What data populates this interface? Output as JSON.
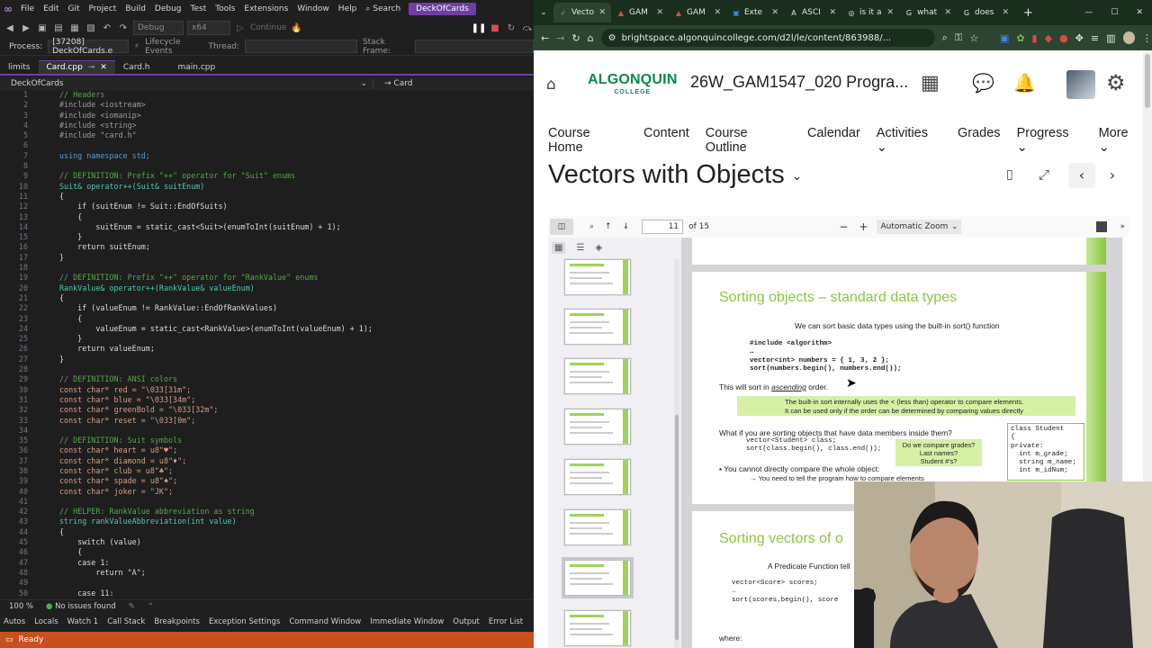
{
  "vs": {
    "menu": [
      "File",
      "Edit",
      "Git",
      "Project",
      "Build",
      "Debug",
      "Test",
      "Tools",
      "Extensions",
      "Window",
      "Help"
    ],
    "search_label": "Search",
    "solution_name": "DeckOfCards",
    "toolbar": {
      "config": "Debug",
      "platform": "x64",
      "continue_label": "Continue"
    },
    "process_label": "Process:",
    "process_value": "[37208] DeckOfCards.e",
    "lifecycle_label": "Lifecycle Events",
    "thread_label": "Thread:",
    "stack_frame_label": "Stack Frame:",
    "tabs": [
      {
        "label": "limits",
        "active": false
      },
      {
        "label": "Card.cpp",
        "active": true
      },
      {
        "label": "Card.h",
        "active": false
      },
      {
        "label": "main.cpp",
        "active": false
      }
    ],
    "nav_left": "DeckOfCards",
    "nav_right": "Card",
    "code_lines": [
      {
        "n": "1",
        "t": "// Headers",
        "c": "c-comment"
      },
      {
        "n": "2",
        "t": "#include <iostream>",
        "c": "c-pp"
      },
      {
        "n": "3",
        "t": "#include <iomanip>",
        "c": "c-pp"
      },
      {
        "n": "4",
        "t": "#include <string>",
        "c": "c-pp"
      },
      {
        "n": "5",
        "t": "#include \"card.h\"",
        "c": "c-pp"
      },
      {
        "n": "6",
        "t": "",
        "c": ""
      },
      {
        "n": "7",
        "t": "using namespace std;",
        "c": "c-kw"
      },
      {
        "n": "8",
        "t": "",
        "c": ""
      },
      {
        "n": "9",
        "t": "// DEFINITION: Prefix \"++\" operator for \"Suit\" enums",
        "c": "c-comment"
      },
      {
        "n": "10",
        "t": "Suit& operator++(Suit& suitEnum)",
        "c": "c-type"
      },
      {
        "n": "11",
        "t": "{",
        "c": ""
      },
      {
        "n": "12",
        "t": "    if (suitEnum != Suit::EndOfSuits)",
        "c": ""
      },
      {
        "n": "13",
        "t": "    {",
        "c": ""
      },
      {
        "n": "14",
        "t": "        suitEnum = static_cast<Suit>(enumToInt(suitEnum) + 1);",
        "c": ""
      },
      {
        "n": "15",
        "t": "    }",
        "c": ""
      },
      {
        "n": "16",
        "t": "    return suitEnum;",
        "c": ""
      },
      {
        "n": "17",
        "t": "}",
        "c": ""
      },
      {
        "n": "18",
        "t": "",
        "c": ""
      },
      {
        "n": "19",
        "t": "// DEFINITION: Prefix \"++\" operator for \"RankValue\" enums",
        "c": "c-comment"
      },
      {
        "n": "20",
        "t": "RankValue& operator++(RankValue& valueEnum)",
        "c": "c-type"
      },
      {
        "n": "21",
        "t": "{",
        "c": ""
      },
      {
        "n": "22",
        "t": "    if (valueEnum != RankValue::EndOfRankValues)",
        "c": ""
      },
      {
        "n": "23",
        "t": "    {",
        "c": ""
      },
      {
        "n": "24",
        "t": "        valueEnum = static_cast<RankValue>(enumToInt(valueEnum) + 1);",
        "c": ""
      },
      {
        "n": "25",
        "t": "    }",
        "c": ""
      },
      {
        "n": "26",
        "t": "    return valueEnum;",
        "c": ""
      },
      {
        "n": "27",
        "t": "}",
        "c": ""
      },
      {
        "n": "28",
        "t": "",
        "c": ""
      },
      {
        "n": "29",
        "t": "// DEFINITION: ANSI colors",
        "c": "c-comment"
      },
      {
        "n": "30",
        "t": "const char* red = \"\\033[31m\";",
        "c": "c-str"
      },
      {
        "n": "31",
        "t": "const char* blue = \"\\033[34m\";",
        "c": "c-str"
      },
      {
        "n": "32",
        "t": "const char* greenBold = \"\\033[32m\";",
        "c": "c-str"
      },
      {
        "n": "33",
        "t": "const char* reset = \"\\033[0m\";",
        "c": "c-str"
      },
      {
        "n": "34",
        "t": "",
        "c": ""
      },
      {
        "n": "35",
        "t": "// DEFINITION: Suit symbols",
        "c": "c-comment"
      },
      {
        "n": "36",
        "t": "const char* heart = u8\"♥\";",
        "c": "c-str"
      },
      {
        "n": "37",
        "t": "const char* diamond = u8\"♦\";",
        "c": "c-str"
      },
      {
        "n": "38",
        "t": "const char* club = u8\"♣\";",
        "c": "c-str"
      },
      {
        "n": "39",
        "t": "const char* spade = u8\"♠\";",
        "c": "c-str"
      },
      {
        "n": "40",
        "t": "const char* joker = \"JK\";",
        "c": "c-str"
      },
      {
        "n": "41",
        "t": "",
        "c": ""
      },
      {
        "n": "42",
        "t": "// HELPER: RankValue abbreviation as string",
        "c": "c-comment"
      },
      {
        "n": "43",
        "t": "string rankValueAbbreviation(int value)",
        "c": "c-type"
      },
      {
        "n": "44",
        "t": "{",
        "c": ""
      },
      {
        "n": "45",
        "t": "    switch (value)",
        "c": ""
      },
      {
        "n": "46",
        "t": "    {",
        "c": ""
      },
      {
        "n": "47",
        "t": "    case 1:",
        "c": ""
      },
      {
        "n": "48",
        "t": "        return \"A\";",
        "c": ""
      },
      {
        "n": "49",
        "t": "",
        "c": ""
      },
      {
        "n": "50",
        "t": "    case 11:",
        "c": ""
      }
    ],
    "zoom": "100 %",
    "issues": "No issues found",
    "bottom_tabs": [
      "Autos",
      "Locals",
      "Watch 1",
      "Call Stack",
      "Breakpoints",
      "Exception Settings",
      "Command Window",
      "Immediate Window",
      "Output",
      "Error List"
    ],
    "status": "Ready",
    "colors": {
      "accent": "#6e3ea6",
      "statusbar": "#c94f1f"
    }
  },
  "browser": {
    "tabs": [
      {
        "label": "Vecto",
        "icon": "d2l-icon",
        "active": true
      },
      {
        "label": "GAM",
        "icon": "pdf-icon",
        "active": false
      },
      {
        "label": "GAM",
        "icon": "pdf-icon",
        "active": false
      },
      {
        "label": "Exte",
        "icon": "doc-icon",
        "active": false
      },
      {
        "label": "ASCI",
        "icon": "a-icon",
        "active": false
      },
      {
        "label": "is it a",
        "icon": "chatgpt-icon",
        "active": false
      },
      {
        "label": "what",
        "icon": "google-icon",
        "active": false
      },
      {
        "label": "does",
        "icon": "google-icon",
        "active": false
      }
    ],
    "url": "brightspace.algonquincollege.com/d2l/le/content/863988/...",
    "logo_main": "ALGONQUIN",
    "logo_sub": "COLLEGE",
    "course_title": "26W_GAM1547_020 Progra...",
    "nav": [
      "Course Home",
      "Content",
      "Course Outline",
      "Calendar",
      "Activities",
      "Grades",
      "Progress",
      "More"
    ],
    "page_title": "Vectors with Objects",
    "pdf": {
      "page": "11",
      "page_total": "of 15",
      "zoom": "Automatic Zoom"
    },
    "slide1": {
      "title": "Sorting objects – standard data types",
      "intro": "We can sort basic data types using the built-in sort() function",
      "code": "#include <algorithm>\n…\nvector<int> numbers = { 1, 3, 2 };\nsort(numbers.begin(), numbers.end());",
      "sort_note_pre": "This will sort in ",
      "sort_note_em": "ascending",
      "sort_note_post": " order.",
      "hl_line1": "The built-in sort internally uses the < (less than) operator to compare elements.",
      "hl_line2": "It can be used only if the order can be determined by comparing values directly",
      "q": "What if you are sorting objects that have data members inside them?",
      "code2": "vector<Student> class;\nsort(class.begin(), class.end());",
      "box_q": "Do we compare grades?\nLast names?\nStudent #'s?",
      "class_box": "class Student\n{\nprivate:\n  int m_grade;\n  string m_name;\n  int m_idNum;",
      "bullet": "You cannot directly compare the whole object:",
      "sub": "→ You need to tell the program how to compare elements"
    },
    "slide2": {
      "title": "Sorting vectors of o",
      "intro": "A Predicate Function tell",
      "code": "vector<Score> scores;\n…\nsort(scores.begin(), score",
      "where": "where:"
    }
  }
}
